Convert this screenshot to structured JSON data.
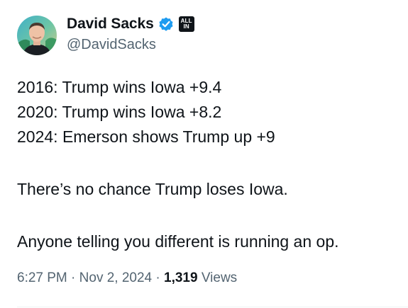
{
  "author": {
    "display_name": "David Sacks",
    "handle": "@DavidSacks",
    "verified_icon": "verified-badge-icon",
    "affiliate_badge": {
      "line1": "ALL",
      "line2": "IN"
    }
  },
  "tweet": {
    "lines": [
      "2016: Trump wins Iowa +9.4",
      "2020: Trump wins Iowa +8.2",
      "2024: Emerson shows Trump up +9"
    ],
    "paragraph2": "There’s no chance Trump loses Iowa.",
    "paragraph3": "Anyone telling you different is running an op."
  },
  "meta": {
    "time": "6:27 PM",
    "separator": "·",
    "date": "Nov 2, 2024",
    "views_count": "1,319",
    "views_label": "Views"
  },
  "colors": {
    "text": "#0f1419",
    "secondary": "#536471",
    "verified_blue": "#1d9bf0",
    "divider": "#eff3f4"
  }
}
